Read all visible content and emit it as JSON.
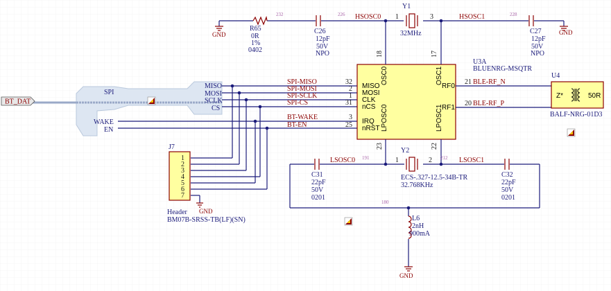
{
  "nets": {
    "bt_dat": "BT_DAT",
    "hsosc0": "HSOSC0",
    "hsosc1": "HSOSC1",
    "lsosc0": "LSOSC0",
    "lsosc1": "LSOSC1",
    "spi_miso": "SPI-MISO",
    "spi_mosi": "SPI-MOSI",
    "spi_sclk": "SPI-SCLK",
    "spi_cs": "SPI-CS",
    "bt_wake": "BT-WAKE",
    "bt_en": "BT-EN",
    "ble_rf_n": "BLE-RF_N",
    "ble_rf_p": "BLE-RF_P",
    "gnd": "GND"
  },
  "harness": {
    "bus_pins": [
      "MISO",
      "MOSI",
      "SCLK",
      "CS"
    ],
    "left_pins": [
      "SPI",
      "WAKE",
      "EN"
    ]
  },
  "net_numbers": {
    "n232": "232",
    "n226": "226",
    "n228": "228",
    "n191": "191",
    "n212": "212",
    "n180": "180"
  },
  "parts": {
    "r65": {
      "ref": "R65",
      "value": "0R",
      "tol": "1%",
      "pkg": "0402"
    },
    "c26": {
      "ref": "C26",
      "value": "12pF",
      "volt": "50V",
      "diel": "NPO"
    },
    "c27": {
      "ref": "C27",
      "value": "12pF",
      "volt": "50V",
      "diel": "NPO"
    },
    "c31": {
      "ref": "C31",
      "value": "22pF",
      "volt": "50V",
      "pkg": "0201"
    },
    "c32": {
      "ref": "C32",
      "value": "22pF",
      "volt": "50V",
      "pkg": "0201"
    },
    "y1": {
      "ref": "Y1",
      "value": "32MHz",
      "pin1": "1",
      "pin3": "3"
    },
    "y2": {
      "ref": "Y2",
      "value": "32.768KHz",
      "part": "ECS-.327-12.5-34B-TR",
      "pin1": "1",
      "pin2": "2"
    },
    "l6": {
      "ref": "L6",
      "value": "2nH",
      "current": "900mA"
    },
    "u4": {
      "ref": "U4",
      "part": "BALF-NRG-01D3",
      "z_label": "Z*",
      "r_label": "50R"
    },
    "j7": {
      "ref": "J7",
      "type": "Header",
      "part": "BM07B-SRSS-TB(LF)(SN)",
      "pins": [
        "1",
        "2",
        "3",
        "4",
        "5",
        "6",
        "7"
      ]
    },
    "u3a": {
      "ref": "U3A",
      "part": "BLUENRG-MSQTR",
      "left_pins": [
        {
          "num": "32",
          "name": "MISO"
        },
        {
          "num": "2",
          "name": "MOSI"
        },
        {
          "num": "1",
          "name": "CLK"
        },
        {
          "num": "31",
          "name": "nCS"
        },
        {
          "num": "3",
          "name": "IRQ"
        },
        {
          "num": "25",
          "name": "nRST"
        }
      ],
      "top_pins": [
        {
          "num": "18",
          "name": "OSC0"
        },
        {
          "num": "17",
          "name": "OSC1"
        }
      ],
      "bottom_pins": [
        {
          "num": "23",
          "name": "LPOSC0"
        },
        {
          "num": "22",
          "name": "LPOSC1"
        }
      ],
      "right_pins": [
        {
          "num": "21",
          "name": "RF0"
        },
        {
          "num": "20",
          "name": "RF1"
        }
      ]
    }
  },
  "colors": {
    "wire": "#1a1a7a",
    "part": "#8b0000",
    "chip_fill": "#ffffa0",
    "harness_fill": "#dde6f2",
    "junction": "#1a1a7a"
  }
}
